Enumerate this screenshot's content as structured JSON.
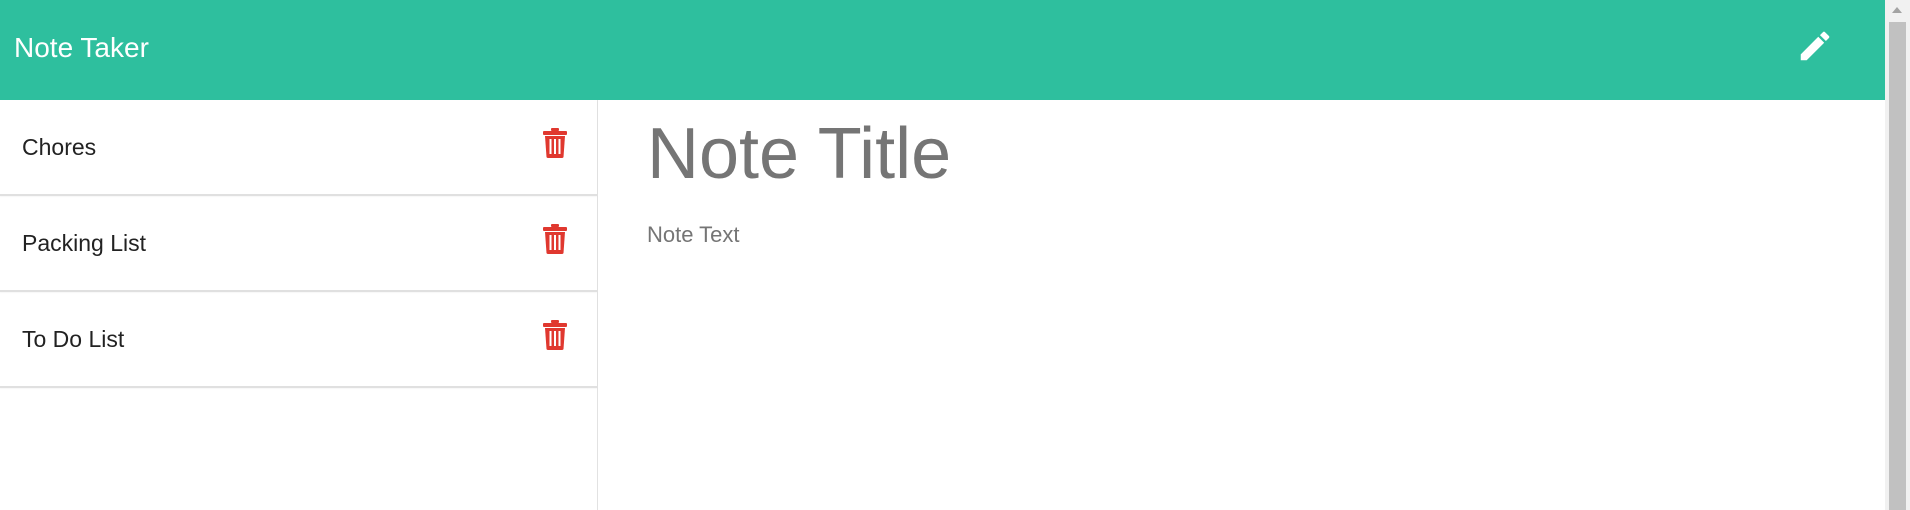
{
  "header": {
    "brand": "Note Taker",
    "new_note_icon": "pencil-icon",
    "background_color": "#2ebf9e"
  },
  "notes": [
    {
      "label": "Chores",
      "delete_icon": "trash-icon"
    },
    {
      "label": "Packing List",
      "delete_icon": "trash-icon"
    },
    {
      "label": "To Do List",
      "delete_icon": "trash-icon"
    }
  ],
  "editor": {
    "title_placeholder": "Note Title",
    "text_placeholder": "Note Text"
  },
  "colors": {
    "accent": "#2ebf9e",
    "delete": "#e0382f",
    "placeholder": "#757575"
  }
}
